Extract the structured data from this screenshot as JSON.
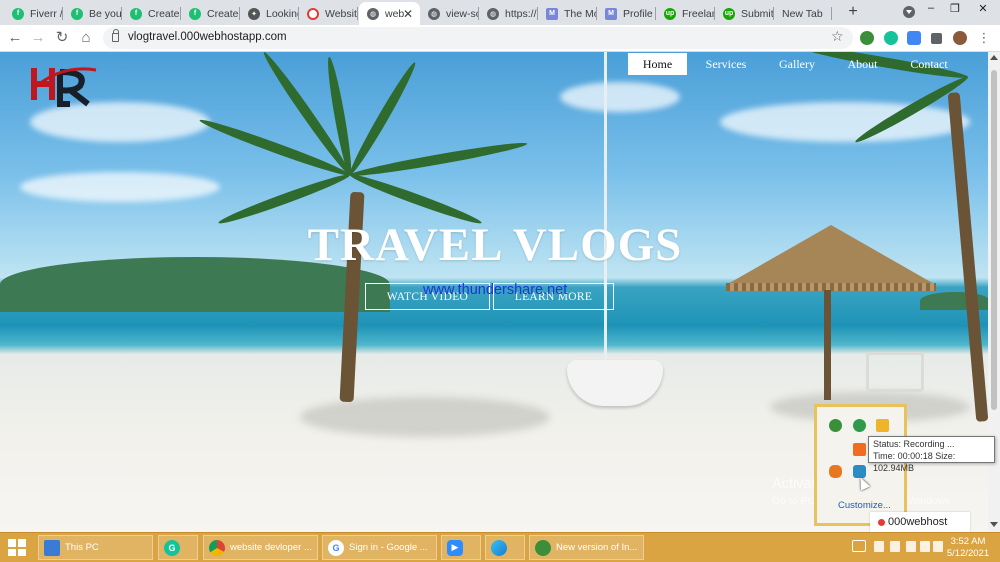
{
  "browser": {
    "tabs": [
      {
        "title": "Fiverr /",
        "favicon": "fiverr-icon",
        "color": "#1dbf73"
      },
      {
        "title": "Be your",
        "favicon": "fiverr-icon",
        "color": "#1dbf73"
      },
      {
        "title": "Create",
        "favicon": "fiverr-icon",
        "color": "#1dbf73"
      },
      {
        "title": "Created",
        "favicon": "fiverr-icon",
        "color": "#1dbf73"
      },
      {
        "title": "Looking",
        "favicon": "people-icon",
        "color": "#555555"
      },
      {
        "title": "Website",
        "favicon": "swirl-icon",
        "color": "#e53935"
      },
      {
        "title": "web",
        "favicon": "globe-icon",
        "color": "#5f6368",
        "active": true
      },
      {
        "title": "view-so",
        "favicon": "globe-icon",
        "color": "#5f6368"
      },
      {
        "title": "https://",
        "favicon": "globe-icon",
        "color": "#5f6368"
      },
      {
        "title": "The Mo",
        "favicon": "m-icon",
        "color": "#7a86d8"
      },
      {
        "title": "Profile",
        "favicon": "m-icon",
        "color": "#7a86d8"
      },
      {
        "title": "Freelan",
        "favicon": "upwork-icon",
        "color": "#14a800"
      },
      {
        "title": "Submit",
        "favicon": "upwork-icon",
        "color": "#14a800"
      },
      {
        "title": "New Tab",
        "favicon": "",
        "color": ""
      }
    ],
    "new_tab_symbol": "+",
    "url": "vlogtravel.000webhostapp.com"
  },
  "site": {
    "nav": [
      {
        "label": "Home",
        "active": true
      },
      {
        "label": "Services"
      },
      {
        "label": "Gallery"
      },
      {
        "label": "About"
      },
      {
        "label": "Contact"
      }
    ],
    "hero_title": "TRAVEL VLOGS",
    "buttons": [
      "WATCH VIDEO",
      "LEARN MORE"
    ],
    "watermark": "www.thundershare.net"
  },
  "os": {
    "activate_title": "Activate Windows",
    "activate_sub": "Go to PC settings to activate Windows.",
    "tray_popup": {
      "customize_label": "Customize...",
      "tooltip_line1": "Status: Recording ...",
      "tooltip_line2": "Time: 00:00:18  Size: 102.94MB"
    },
    "notification_chip": "000webhost",
    "taskbar": [
      {
        "label": "This PC",
        "icon": "computer-icon"
      },
      {
        "label": "",
        "icon": "grammarly-icon"
      },
      {
        "label": "website devloper ...",
        "icon": "chrome-icon"
      },
      {
        "label": "Sign in - Google ...",
        "icon": "google-icon"
      },
      {
        "label": "",
        "icon": "zoom-icon"
      },
      {
        "label": "",
        "icon": "edge-icon"
      },
      {
        "label": "New version of In...",
        "icon": "download-manager-icon"
      }
    ],
    "clock_time": "3:52 AM",
    "clock_date": "5/12/2021"
  }
}
